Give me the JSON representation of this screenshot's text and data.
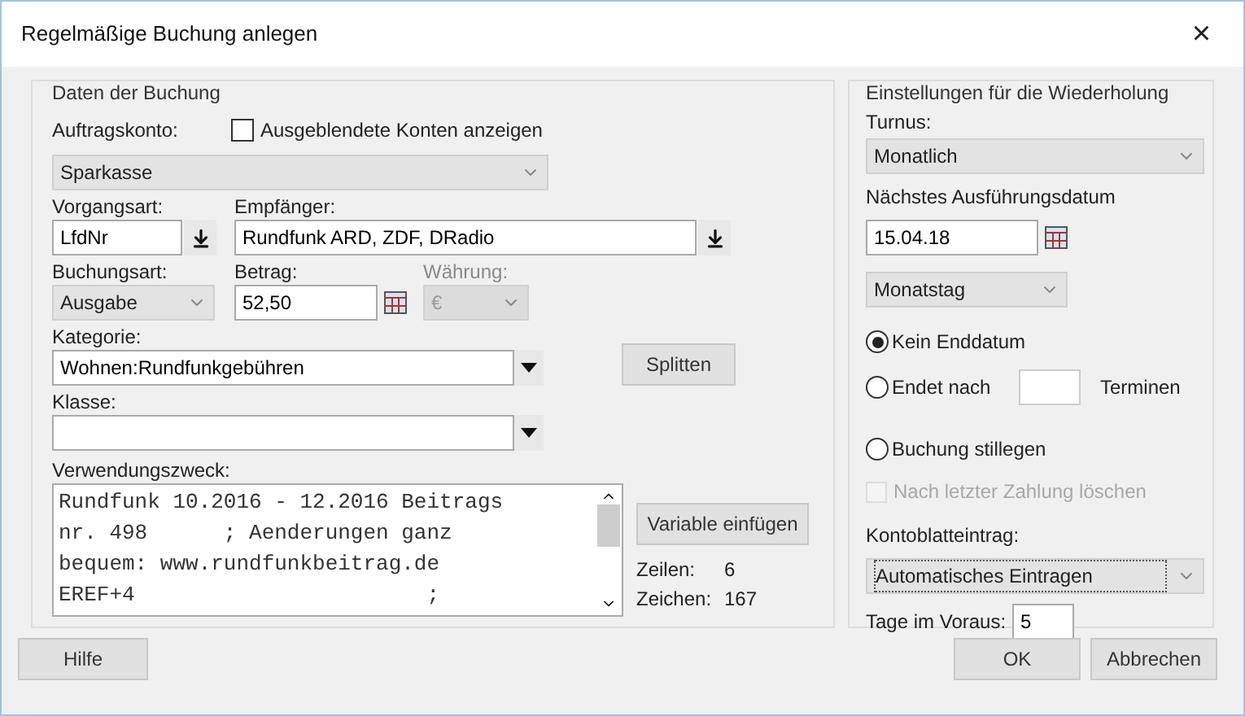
{
  "window": {
    "title": "Regelmäßige Buchung anlegen",
    "close": "×"
  },
  "booking": {
    "legend": "Daten der Buchung",
    "account": {
      "label": "Auftragskonto:",
      "value": "Sparkasse"
    },
    "show_hidden": {
      "label": "Ausgeblendete Konten anzeigen",
      "checked": false
    },
    "transaction_type": {
      "label": "Vorgangsart:",
      "value": "LfdNr"
    },
    "recipient": {
      "label": "Empfänger:",
      "value": "Rundfunk ARD, ZDF, DRadio"
    },
    "booking_type": {
      "label": "Buchungsart:",
      "value": "Ausgabe"
    },
    "amount": {
      "label": "Betrag:",
      "value": "52,50"
    },
    "currency": {
      "label": "Währung:",
      "value": "€",
      "disabled": true
    },
    "category": {
      "label": "Kategorie:",
      "value": "Wohnen:Rundfunkgebühren"
    },
    "split_button": "Splitten",
    "class": {
      "label": "Klasse:"
    },
    "purpose": {
      "label": "Verwendungszweck:",
      "lines": [
        "Rundfunk 10.2016 - 12.2016 Beitrags",
        "nr. 498      ; Aenderungen ganz",
        "bequem: www.rundfunkbeitrag.de",
        "EREF+4                       ;"
      ]
    },
    "insert_variable_button": "Variable einfügen",
    "lines_count": {
      "label": "Zeilen:",
      "value": "6"
    },
    "chars_count": {
      "label": "Zeichen:",
      "value": "167"
    }
  },
  "recurrence": {
    "legend": "Einstellungen für die Wiederholung",
    "cycle": {
      "label": "Turnus:",
      "value": "Monatlich"
    },
    "next_date": {
      "label": "Nächstes Ausführungsdatum",
      "value": "15.04.18"
    },
    "day_mode": {
      "value": "Monatstag"
    },
    "end_options": [
      {
        "label": "Kein Enddatum",
        "selected": true
      },
      {
        "label": "Endet nach",
        "selected": false,
        "suffix": "Terminen"
      }
    ],
    "suspend": {
      "label": "Buchung stillegen",
      "selected": false
    },
    "delete_after_last": {
      "label": "Nach letzter Zahlung löschen",
      "checked": false,
      "disabled": true
    },
    "ledger_entry": {
      "label": "Kontoblatteintrag:",
      "value": "Automatisches Eintragen"
    },
    "days_ahead": {
      "label": "Tage im Voraus:",
      "value": "5"
    }
  },
  "buttons": {
    "help": "Hilfe",
    "ok": "OK",
    "cancel": "Abbrechen"
  }
}
